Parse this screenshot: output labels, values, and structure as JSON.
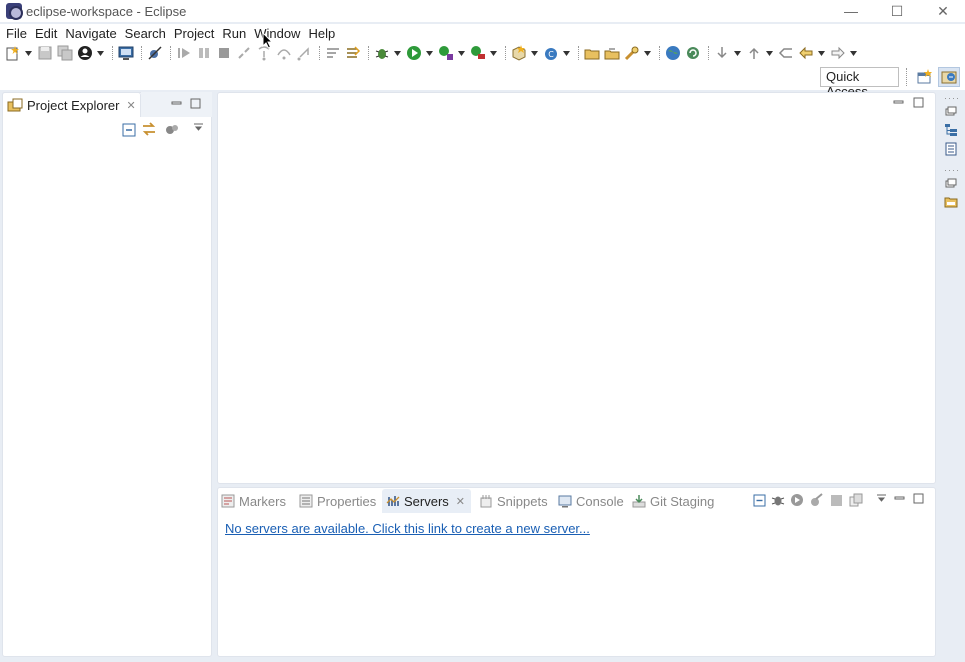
{
  "window": {
    "title": "eclipse-workspace - Eclipse",
    "minimize_glyph": "—",
    "maximize_glyph": "☐",
    "close_glyph": "✕"
  },
  "menu": [
    "File",
    "Edit",
    "Navigate",
    "Search",
    "Project",
    "Run",
    "Window",
    "Help"
  ],
  "toolbar": {
    "quick_access": "Quick Access"
  },
  "project_explorer": {
    "tab_label": "Project Explorer",
    "close_glyph": "✕"
  },
  "bottom_panel": {
    "tabs": [
      {
        "label": "Markers",
        "icon": "markers-icon"
      },
      {
        "label": "Properties",
        "icon": "properties-icon"
      },
      {
        "label": "Servers",
        "icon": "servers-icon",
        "active": true
      },
      {
        "label": "Snippets",
        "icon": "snippets-icon"
      },
      {
        "label": "Console",
        "icon": "console-icon"
      },
      {
        "label": "Git Staging",
        "icon": "git-staging-icon"
      }
    ],
    "servers_close_glyph": "✕",
    "servers_message": "No servers are available. Click this link to create a new server..."
  },
  "colors": {
    "background": "#e8edf4",
    "link": "#1a5fb4",
    "active_tab": "#e8eef6"
  }
}
